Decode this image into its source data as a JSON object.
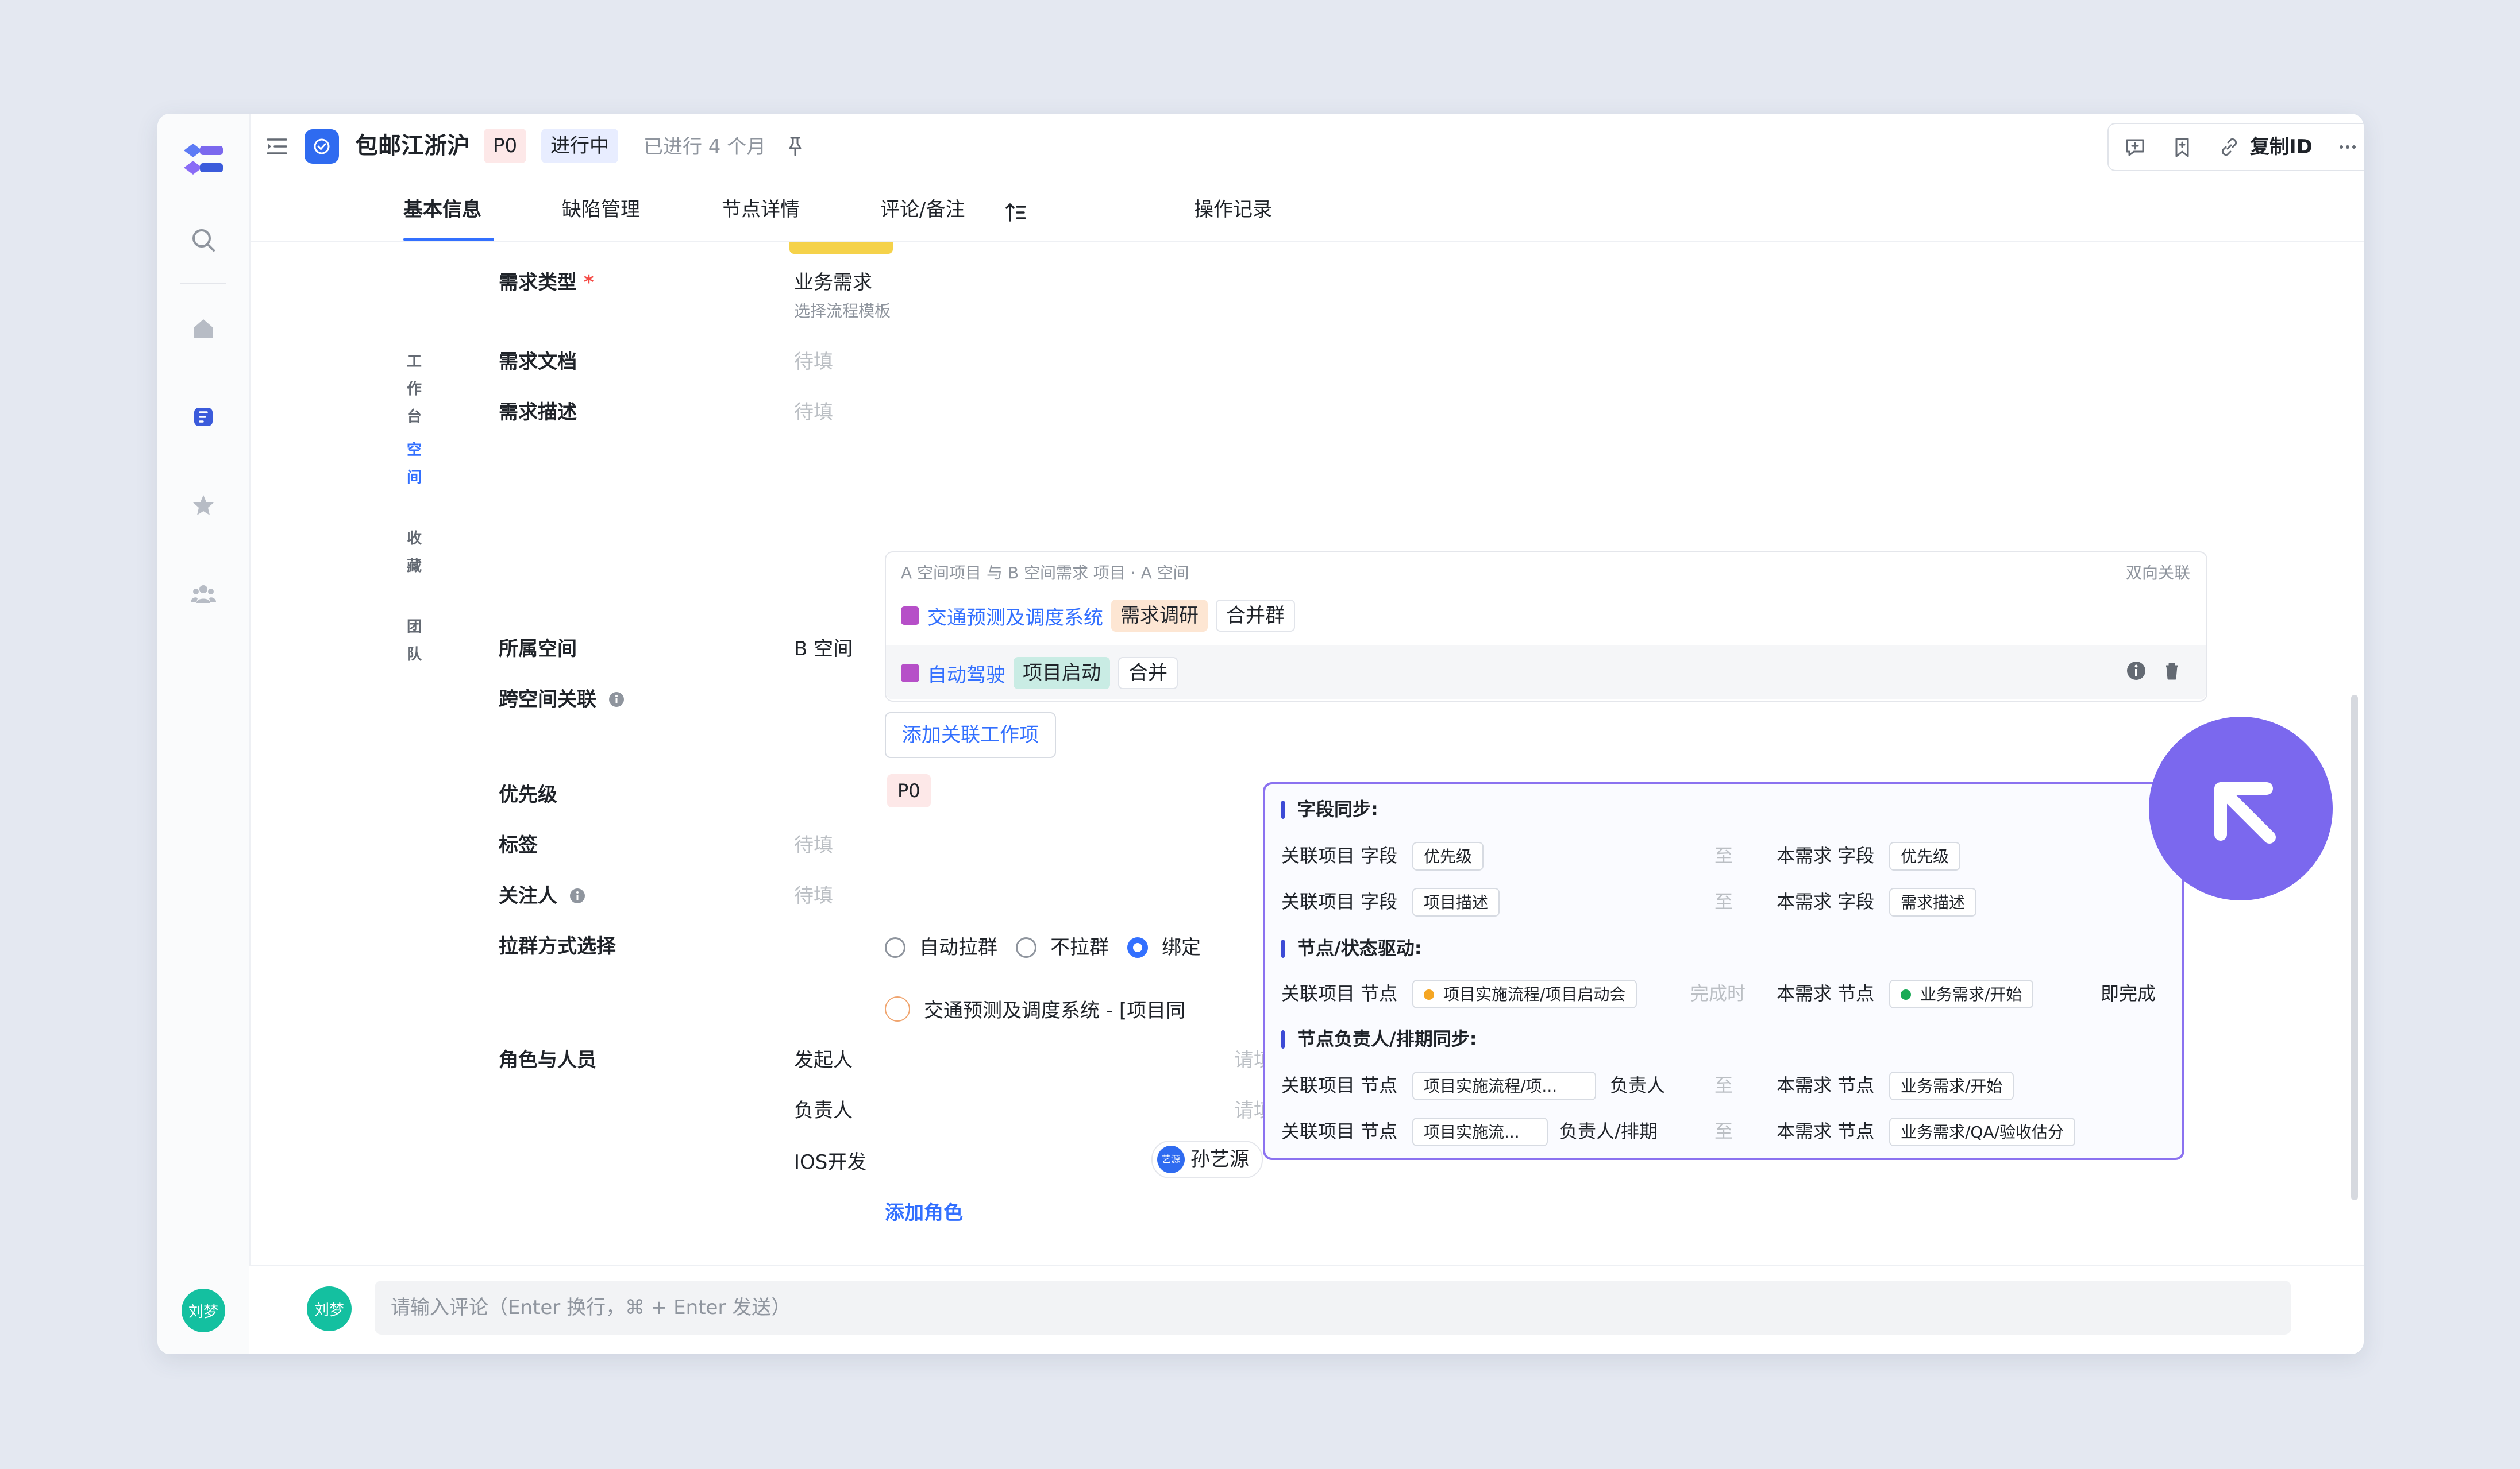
{
  "header": {
    "title": "包邮江浙沪",
    "priority": "P0",
    "status": "进行中",
    "elapsed": "已进行 4 个月",
    "copy_id": "复制ID"
  },
  "rail": {
    "items": [
      {
        "label": "工作台",
        "icon": "home-icon"
      },
      {
        "label": "空间",
        "icon": "space-icon"
      },
      {
        "label": "收藏",
        "icon": "star-icon"
      },
      {
        "label": "团队",
        "icon": "team-icon"
      }
    ],
    "user_avatar": "刘梦"
  },
  "tabs": [
    "基本信息",
    "缺陷管理",
    "节点详情",
    "评论/备注",
    "操作记录"
  ],
  "fields": {
    "req_type_label": "需求类型",
    "req_type_required": "*",
    "req_type_value": "业务需求",
    "req_type_sub": "选择流程模板",
    "req_doc_label": "需求文档",
    "req_doc_value": "待填",
    "req_desc_label": "需求描述",
    "req_desc_value": "待填",
    "space_label": "所属空间",
    "space_value": "B 空间",
    "cross_label": "跨空间关联",
    "priority_label": "优先级",
    "priority_value": "P0",
    "tags_label": "标签",
    "tags_value": "待填",
    "followers_label": "关注人",
    "followers_value": "待填",
    "group_method_label": "拉群方式选择",
    "roles_label": "角色与人员"
  },
  "cross_space": {
    "meta": "A 空间项目 与 B 空间需求  项目 · A 空间",
    "bidirectional": "双向关联",
    "rows": [
      {
        "project": "交通预测及调度系统",
        "node": "需求调研",
        "action": "合并群"
      },
      {
        "project": "自动驾驶",
        "node": "项目启动",
        "action": "合并"
      }
    ],
    "add_button": "添加关联工作项"
  },
  "group_method": {
    "options": [
      "自动拉群",
      "不拉群",
      "绑定"
    ],
    "selected": 2,
    "group_name": "交通预测及调度系统 - [项目同"
  },
  "roles": [
    {
      "role": "发起人",
      "placeholder": "请填写发起人"
    },
    {
      "role": "负责人",
      "placeholder": "请填写负责人"
    },
    {
      "role": "IOS开发",
      "person": "孙艺源",
      "avatar": "艺源"
    }
  ],
  "add_role": "添加角色",
  "popover": {
    "sections": {
      "field_sync": "字段同步:",
      "node_drive": "节点/状态驱动:",
      "owner_sync": "节点负责人/排期同步:"
    },
    "rel_field": "关联项目 字段",
    "rel_node": "关联项目 节点",
    "this_field": "本需求 字段",
    "this_node": "本需求 节点",
    "to": "至",
    "when_done": "完成时",
    "instant_done": "即完成",
    "owner": "负责人",
    "owner_schedule": "负责人/排期",
    "chips": {
      "priority": "优先级",
      "proj_desc": "项目描述",
      "req_desc": "需求描述",
      "proj_kickoff": "项目实施流程/项目启动会",
      "biz_start": "业务需求/开始",
      "proj_flow1": "项目实施流程/项...",
      "proj_flow2": "项目实施流...",
      "qa_eval": "业务需求/QA/验收估分"
    },
    "colors": {
      "kickoff_dot": "#f5a623",
      "start_dot": "#1aaa55",
      "border": "#8b72f0"
    }
  },
  "comment": {
    "avatar": "刘梦",
    "placeholder": "请输入评论（Enter 换行，⌘ + Enter 发送）"
  },
  "colors": {
    "accent": "#3370ff",
    "fab": "#7b68ee"
  }
}
